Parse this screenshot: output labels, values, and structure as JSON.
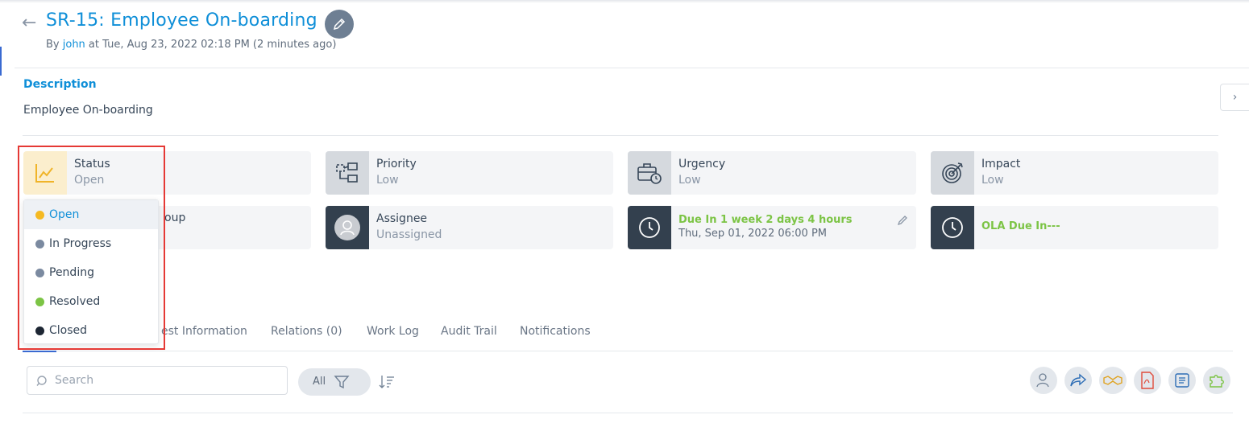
{
  "header": {
    "title": "SR-15: Employee On-boarding",
    "by_prefix": "By ",
    "author": "john",
    "by_suffix": " at Tue, Aug 23, 2022 02:18 PM (2 minutes ago)"
  },
  "description": {
    "label": "Description",
    "text": "Employee On-boarding"
  },
  "cards": {
    "status": {
      "label": "Status",
      "value": "Open"
    },
    "priority": {
      "label": "Priority",
      "value": "Low"
    },
    "urgency": {
      "label": "Urgency",
      "value": "Low"
    },
    "impact": {
      "label": "Impact",
      "value": "Low"
    },
    "group_tail": "oup",
    "assignee": {
      "label": "Assignee",
      "value": "Unassigned"
    },
    "due": {
      "label": "Due In 1 week 2 days 4 hours",
      "date": "Thu, Sep 01, 2022 06:00 PM"
    },
    "ola": {
      "label": "OLA Due In---"
    }
  },
  "status_dropdown": {
    "options": [
      {
        "label": "Open",
        "color": "#f5b922"
      },
      {
        "label": "In Progress",
        "color": "#7b8aa0"
      },
      {
        "label": "Pending",
        "color": "#7b8aa0"
      },
      {
        "label": "Resolved",
        "color": "#7cc445"
      },
      {
        "label": "Closed",
        "color": "#1d2633"
      }
    ],
    "selected": "Open"
  },
  "tabs": {
    "request_info_partial": "est Information",
    "relations": "Relations (0)",
    "work_log": "Work Log",
    "audit_trail": "Audit Trail",
    "notifications": "Notifications"
  },
  "toolbar": {
    "search_placeholder": "Search",
    "filter_label": "All"
  },
  "icons": {
    "status": "trend-chart-icon",
    "priority": "workflow-icon",
    "urgency": "briefcase-clock-icon",
    "impact": "target-icon",
    "assignee": "user-avatar-icon",
    "due": "clock-icon",
    "actions": [
      "assign-user-icon",
      "forward-icon",
      "handshake-icon",
      "pdf-icon",
      "script-icon",
      "plugin-icon"
    ]
  },
  "colors": {
    "accent": "#0f8fd8",
    "due_green": "#7cc445",
    "highlight": "#e53935"
  }
}
